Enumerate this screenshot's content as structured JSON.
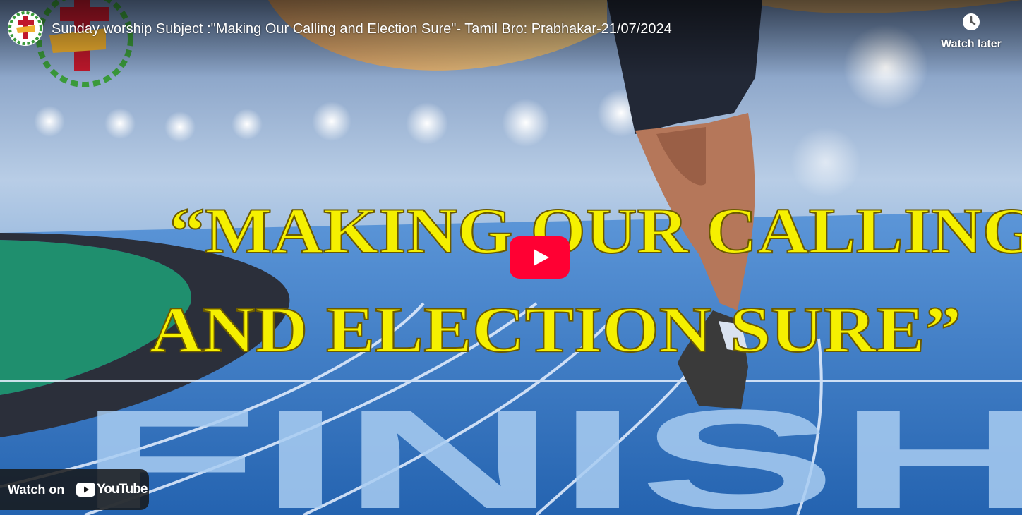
{
  "video": {
    "title": "Sunday worship Subject :\"Making Our Calling and Election Sure\"- Tamil Bro: Prabhakar-21/07/2024"
  },
  "thumbnail": {
    "headline_line1": "“MAKING OUR CALLING",
    "headline_line2": "AND ELECTION SURE”",
    "track_text": "FINISH"
  },
  "controls": {
    "watch_later_label": "Watch later",
    "watch_on_label": "Watch on",
    "youtube_wordmark": "YouTube"
  },
  "icons": {
    "channel": "church-cross-logo-icon",
    "watch_later": "clock-icon",
    "play": "play-icon",
    "youtube": "youtube-logo-icon"
  },
  "colors": {
    "headline": "#f5f000",
    "play_button": "#ff0033",
    "track": "#2f74c8"
  }
}
